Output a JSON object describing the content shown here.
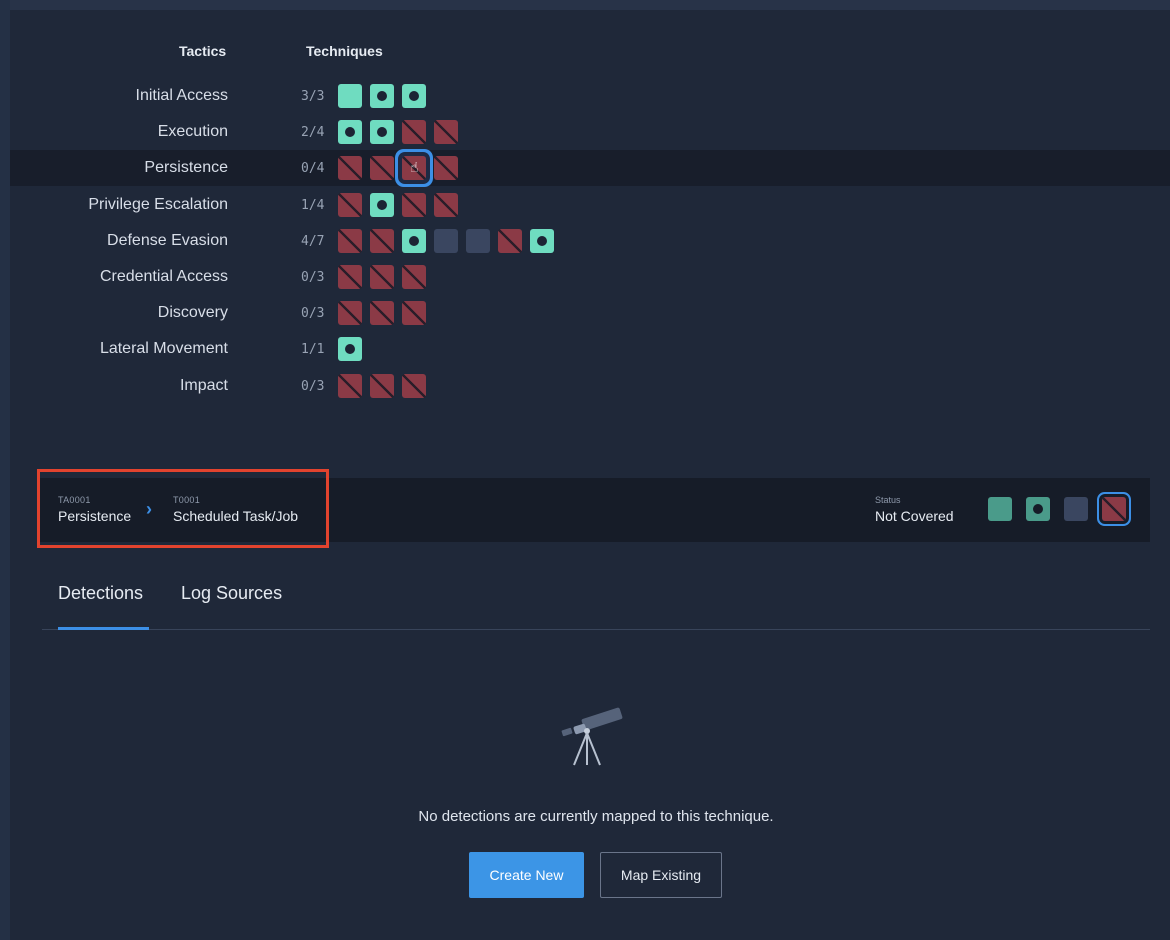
{
  "matrix": {
    "header_tactics": "Tactics",
    "header_techniques": "Techniques",
    "rows": [
      {
        "tactic": "Initial Access",
        "count": "3/3",
        "cells": [
          "cov",
          "det",
          "det"
        ]
      },
      {
        "tactic": "Execution",
        "count": "2/4",
        "cells": [
          "det",
          "det",
          "nc",
          "nc"
        ]
      },
      {
        "tactic": "Persistence",
        "count": "0/4",
        "cells": [
          "nc",
          "nc",
          "nc",
          "nc"
        ],
        "highlighted": true,
        "selected_cell": 2
      },
      {
        "tactic": "Privilege Escalation",
        "count": "1/4",
        "cells": [
          "nc",
          "det",
          "nc",
          "nc"
        ]
      },
      {
        "tactic": "Defense Evasion",
        "count": "4/7",
        "cells": [
          "nc",
          "nc",
          "det",
          "na",
          "na",
          "nc",
          "det"
        ]
      },
      {
        "tactic": "Credential Access",
        "count": "0/3",
        "cells": [
          "nc",
          "nc",
          "nc"
        ]
      },
      {
        "tactic": "Discovery",
        "count": "0/3",
        "cells": [
          "nc",
          "nc",
          "nc"
        ]
      },
      {
        "tactic": "Lateral Movement",
        "count": "1/1",
        "cells": [
          "det"
        ]
      },
      {
        "tactic": "Impact",
        "count": "0/3",
        "cells": [
          "nc",
          "nc",
          "nc"
        ]
      }
    ]
  },
  "detail": {
    "tactic_id": "TA0001",
    "tactic_name": "Persistence",
    "technique_id": "T0001",
    "technique_name": "Scheduled Task/Job",
    "status_label": "Status",
    "status_value": "Not Covered",
    "status_options": [
      "cov",
      "det",
      "na",
      "nc"
    ],
    "status_selected": "nc"
  },
  "tabs": {
    "detections": "Detections",
    "log_sources": "Log Sources",
    "active": "detections"
  },
  "empty_state": {
    "icon": "telescope-icon",
    "message": "No detections are currently mapped to this technique.",
    "create_label": "Create New",
    "map_label": "Map Existing"
  },
  "colors": {
    "accent": "#3c8fe6",
    "covered": "#6fdcc0",
    "not_covered": "#8b3a46",
    "not_applicable": "#3a4660",
    "annotation": "#e2432e"
  }
}
